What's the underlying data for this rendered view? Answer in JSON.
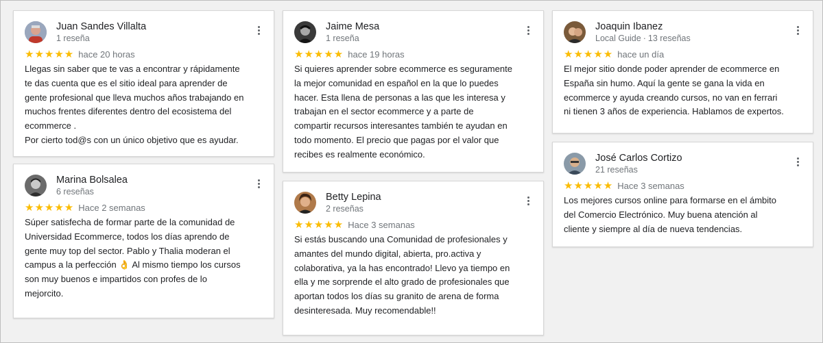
{
  "reviews": [
    {
      "name": "Juan Sandes Villalta",
      "meta": "1 reseña",
      "badge": "",
      "stars": "★★★★★",
      "rating": 5,
      "time": "hace 20 horas",
      "text": "Llegas sin saber que te vas a encontrar y rápidamente\nte das cuenta que es el sitio ideal para aprender de\ngente profesional que lleva muchos años trabajando en\nmuchos frentes diferentes dentro del ecosistema del\necommerce .\nPor cierto tod@s con un único objetivo que es ayudar."
    },
    {
      "name": "Marina Bolsalea",
      "meta": "6 reseñas",
      "badge": "",
      "stars": "★★★★★",
      "rating": 5,
      "time": "Hace 2 semanas",
      "text": "Súper satisfecha de formar parte de la comunidad de\nUniversidad Ecommerce, todos los días aprendo de\ngente muy top del sector. Pablo y Thalia moderan el\ncampus a la perfección 👌 Al mismo tiempo los cursos\nson muy buenos e impartidos con profes de lo\nmejorcito."
    },
    {
      "name": "Jaime Mesa",
      "meta": "1 reseña",
      "badge": "",
      "stars": "★★★★★",
      "rating": 5,
      "time": "hace 19 horas",
      "text": "Si quieres aprender sobre ecommerce es seguramente\nla mejor comunidad en español en la que lo puedes\nhacer. Esta llena de personas a las que les interesa y\ntrabajan en el sector ecommerce y a parte de\ncompartir recursos interesantes también te ayudan en\ntodo momento. El precio que pagas por el valor que\nrecibes es realmente económico."
    },
    {
      "name": "Betty Lepina",
      "meta": "2 reseñas",
      "badge": "",
      "stars": "★★★★★",
      "rating": 5,
      "time": "Hace 3 semanas",
      "text": "Si estás buscando una Comunidad de profesionales y\namantes del mundo digital, abierta, pro.activa y\ncolaborativa, ya la has encontrado! Llevo ya tiempo en\nella y me sorprende el alto grado de profesionales que\naportan todos los días su granito de arena de forma\ndesinteresada. Muy recomendable!!"
    },
    {
      "name": "Joaquin Ibanez",
      "meta": "13 reseñas",
      "badge": "Local Guide",
      "stars": "★★★★★",
      "rating": 5,
      "time": "hace un día",
      "text": "El mejor sitio donde poder aprender de ecommerce en\nEspaña sin humo. Aquí la gente se gana la vida en\necommerce y ayuda creando cursos, no van en ferrari\nni tienen 3 años de experiencia. Hablamos de expertos."
    },
    {
      "name": "José Carlos Cortizo",
      "meta": "21 reseñas",
      "badge": "",
      "stars": "★★★★★",
      "rating": 5,
      "time": "Hace 3 semanas",
      "text": "Los mejores cursos online para formarse en el ámbito\ndel Comercio Electrónico. Muy buena atención al\ncliente y siempre al día de nueva tendencias."
    }
  ],
  "colors": {
    "star": "#fbbc04",
    "secondary_text": "#70757a",
    "primary_text": "#202124"
  }
}
